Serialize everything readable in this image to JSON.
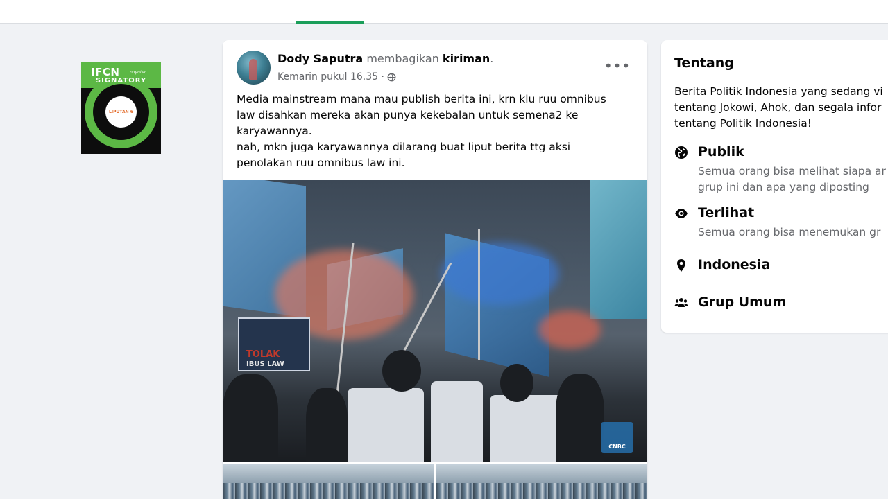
{
  "badge": {
    "ifcn": "IFCN",
    "ifcn_sub": "poynter",
    "signatory": "SIGNATORY",
    "member_name": "LIPUTAN 6"
  },
  "post": {
    "author": "Dody Saputra",
    "action": " membagikan ",
    "object": "kiriman",
    "suffix": ".",
    "timestamp": "Kemarin pukul 16.35 ·",
    "more_label": "•••",
    "text_lines": [
      "Media mainstream mana mau publish berita ini, krn klu ruu omnibus",
      "law disahkan mereka akan punya kekebalan untuk semena2 ke",
      "karyawannya.",
      "nah, mkn juga karyawannya dilarang buat liput berita ttg aksi",
      "penolakan ruu omnibus law ini."
    ],
    "photo_sign_line1": "TOLAK",
    "photo_sign_line2": "IBUS LAW",
    "photo_watermark": "CNBC"
  },
  "about": {
    "title": "Tentang",
    "desc_lines": [
      "Berita Politik Indonesia yang sedang vi",
      "tentang Jokowi, Ahok, dan segala infor",
      "tentang Politik Indonesia!"
    ],
    "items": [
      {
        "icon": "globe-icon",
        "label": "Publik",
        "sub": [
          "Semua orang bisa melihat siapa ar",
          "grup ini dan apa yang diposting"
        ]
      },
      {
        "icon": "eye-icon",
        "label": "Terlihat",
        "sub": [
          "Semua orang bisa menemukan gr"
        ]
      },
      {
        "icon": "location-pin-icon",
        "label": "Indonesia",
        "sub": []
      },
      {
        "icon": "group-people-icon",
        "label": "Grup Umum",
        "sub": []
      }
    ]
  }
}
